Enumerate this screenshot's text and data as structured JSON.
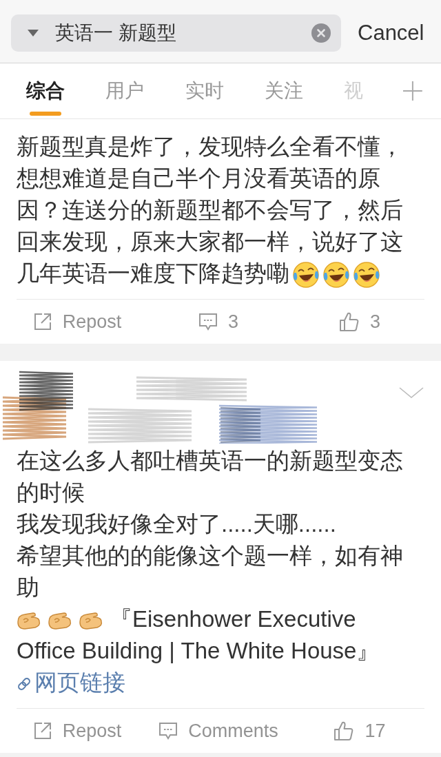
{
  "search": {
    "value": "英语一 新题型"
  },
  "cancel_button": {
    "label": "Cancel"
  },
  "tabs": [
    {
      "label": "综合",
      "selected": true,
      "faded": false
    },
    {
      "label": "用户",
      "selected": false,
      "faded": false
    },
    {
      "label": "实时",
      "selected": false,
      "faded": false
    },
    {
      "label": "关注",
      "selected": false,
      "faded": false
    },
    {
      "label": "视",
      "selected": false,
      "faded": true
    }
  ],
  "posts": [
    {
      "blocks": [
        [
          {
            "kind": "text",
            "text": "新题型真是炸了，发现特么全看不懂，想想难道是自己半个月没看英语的原因？连送分的新题型都不会写了，然后回来发现，原来大家都一样，说好了这"
          }
        ],
        [
          {
            "kind": "text",
            "text": "几年英语一难度下降趋势嘞"
          },
          {
            "kind": "laugh"
          },
          {
            "kind": "laugh"
          },
          {
            "kind": "laugh"
          }
        ]
      ],
      "actions": [
        {
          "kind": "repost",
          "label": "Repost"
        },
        {
          "kind": "comment",
          "label": "3"
        },
        {
          "kind": "like",
          "label": "3"
        }
      ]
    },
    {
      "author": {
        "redacted": true
      },
      "blocks": [
        [
          {
            "kind": "text",
            "text": "在这么多人都吐槽英语一的新题型变态的时候"
          }
        ],
        [
          {
            "kind": "text",
            "text": "我发现我好像全对了.....天哪......"
          }
        ],
        [
          {
            "kind": "text",
            "text": "希望其他的的能像这个题一样，如有神助"
          }
        ],
        [
          {
            "kind": "hand"
          },
          {
            "kind": "hand"
          },
          {
            "kind": "hand"
          },
          {
            "kind": "text",
            "text": "『Eisenhower Executive"
          }
        ],
        [
          {
            "kind": "text",
            "text": "Office Building | The White House』"
          }
        ],
        [
          {
            "kind": "link",
            "text": "网页链接"
          }
        ]
      ],
      "actions": [
        {
          "kind": "repost",
          "label": "Repost"
        },
        {
          "kind": "comment",
          "label": "Comments"
        },
        {
          "kind": "like",
          "label": "17"
        }
      ]
    }
  ]
}
